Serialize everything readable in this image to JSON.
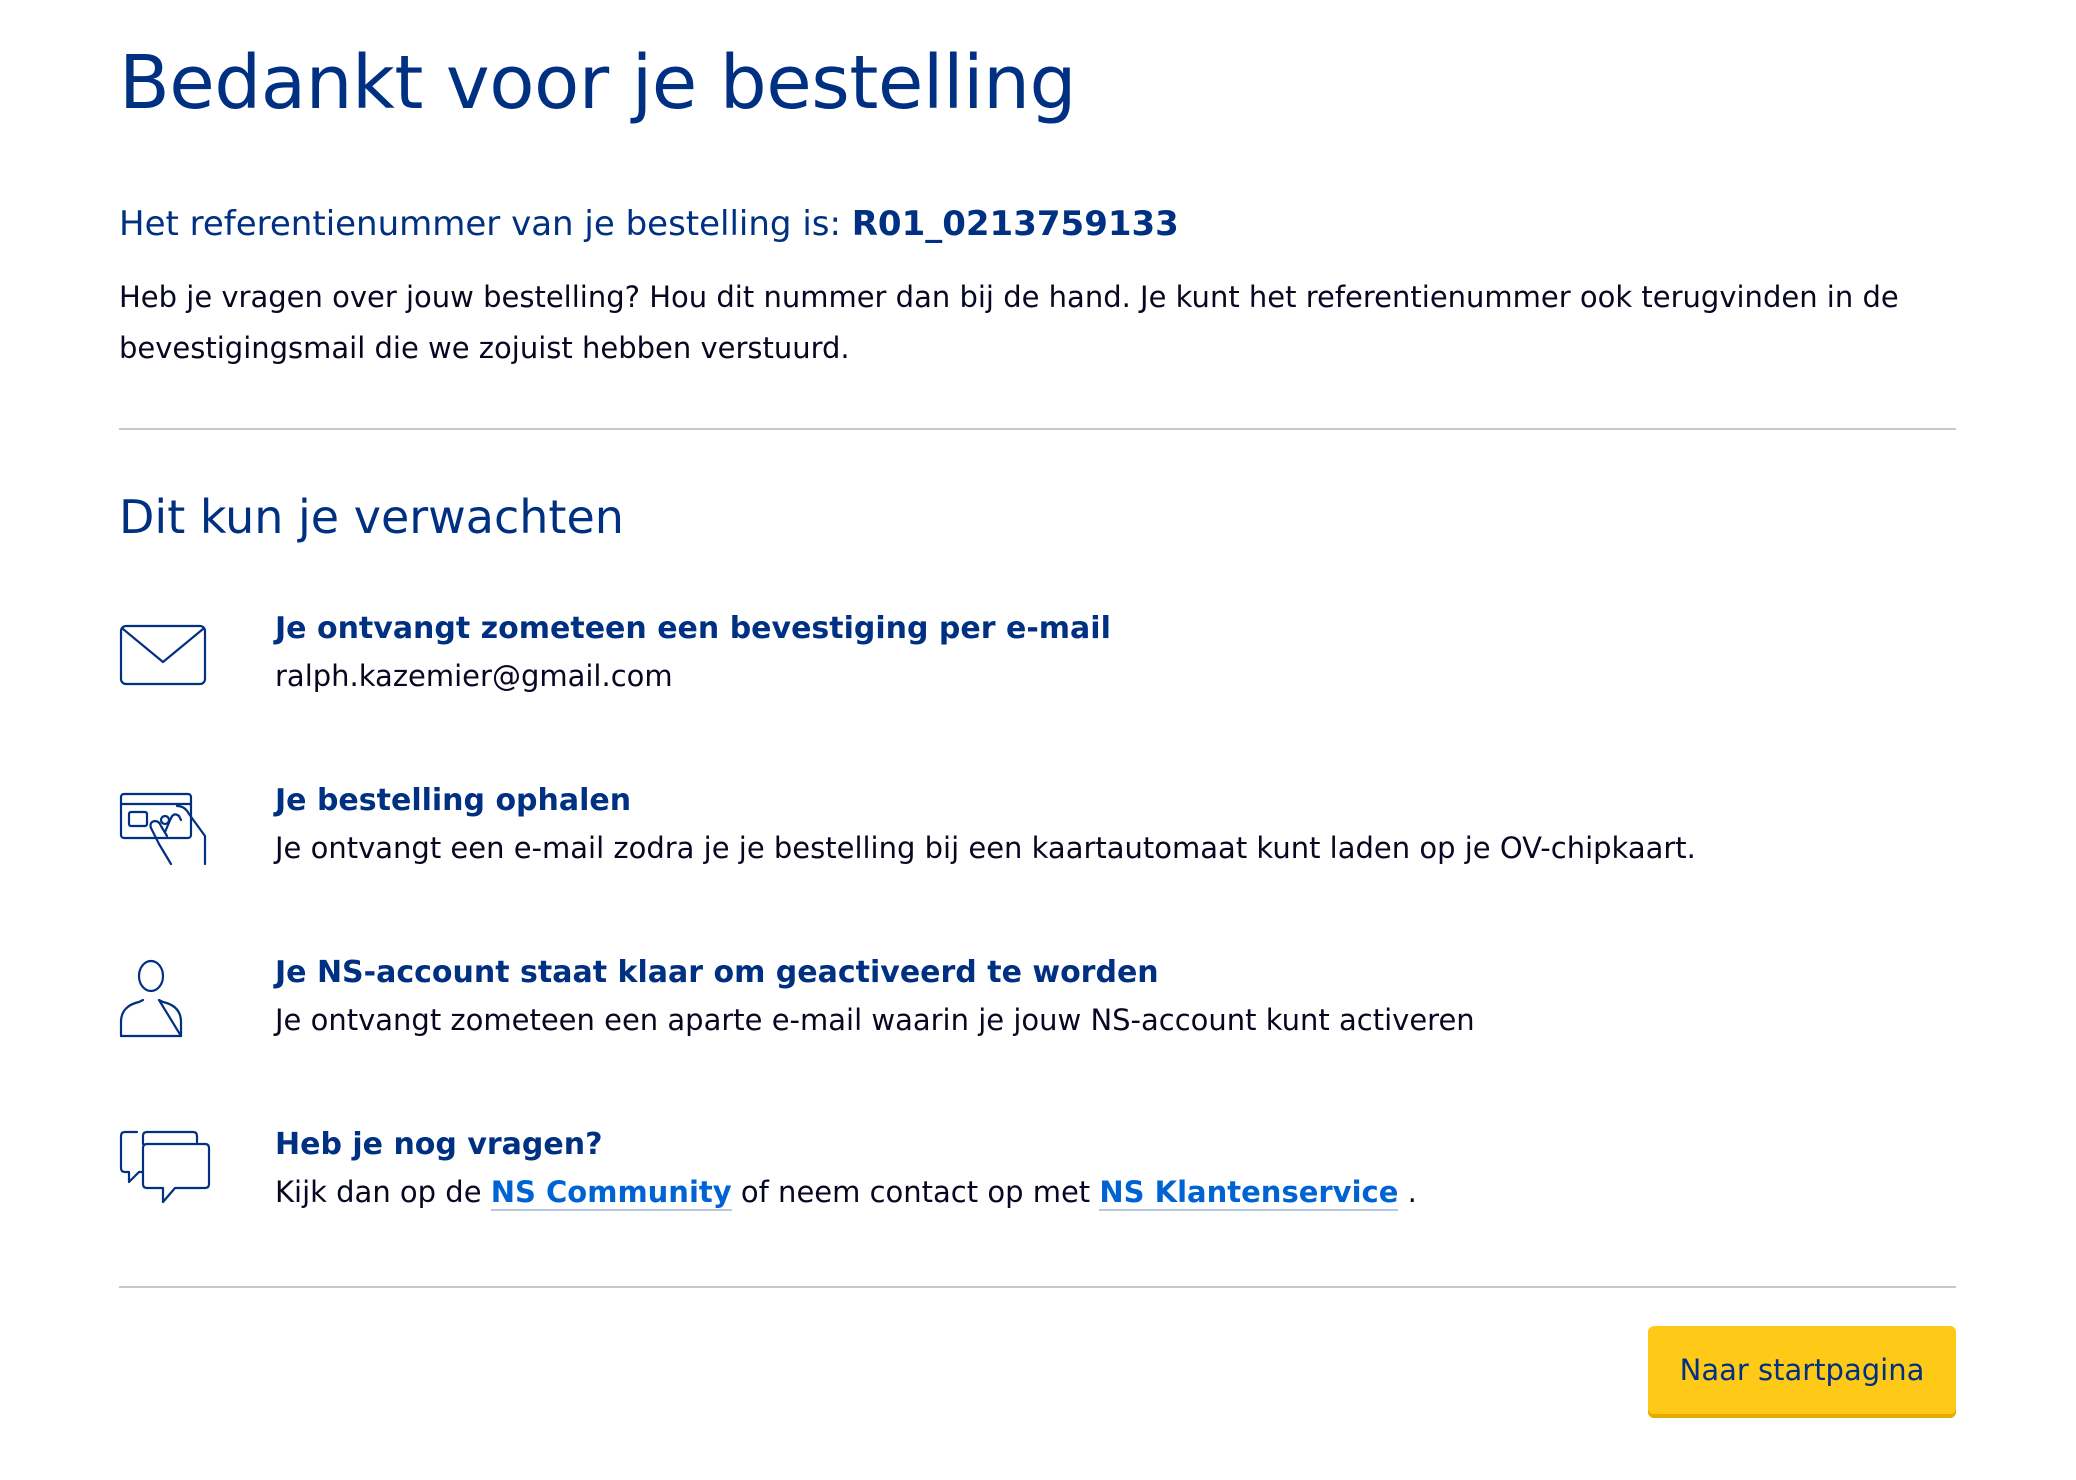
{
  "page": {
    "title": "Bedankt voor je bestelling",
    "reference": {
      "label": "Het referentienummer van je bestelling is:",
      "number": "R01_0213759133"
    },
    "intro": "Heb je vragen over jouw bestelling? Hou dit nummer dan bij de hand. Je kunt het referentienummer ook terugvinden in de bevestigingsmail die we zojuist hebben verstuurd."
  },
  "expect": {
    "title": "Dit kun je verwachten",
    "items": [
      {
        "icon": "envelope-icon",
        "heading": "Je ontvangt zometeen een bevestiging per e-mail",
        "body": "ralph.kazemier@gmail.com"
      },
      {
        "icon": "card-pickup-icon",
        "heading": "Je bestelling ophalen",
        "body": "Je ontvangt een e-mail zodra je je bestelling bij een kaartautomaat kunt laden op je OV-chipkaart."
      },
      {
        "icon": "user-icon",
        "heading": "Je NS-account staat klaar om geactiveerd te worden",
        "body": "Je ontvangt zometeen een aparte e-mail waarin je jouw NS-account kunt activeren"
      },
      {
        "icon": "chat-bubbles-icon",
        "heading": "Heb je nog vragen?",
        "body_prefix": "Kijk dan op de",
        "link1": "NS Community",
        "body_middle": "of neem contact op met",
        "link2": "NS Klantenservice",
        "body_suffix": "."
      }
    ]
  },
  "actions": {
    "home_button": "Naar startpagina"
  },
  "colors": {
    "primary_blue": "#003082",
    "link_blue": "#0063d3",
    "button_yellow": "#ffc917",
    "divider": "#c8c8cc"
  }
}
